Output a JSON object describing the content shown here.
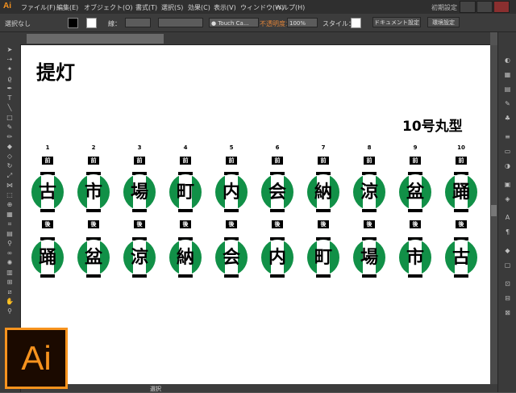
{
  "app": {
    "logo": "Ai",
    "menus": [
      "ファイル(F)",
      "編集(E)",
      "オブジェクト(O)",
      "書式(T)",
      "選択(S)",
      "効果(C)",
      "表示(V)",
      "ウィンドウ(W)",
      "ヘルプ(H)"
    ],
    "workspace": "初期設定",
    "brand_color": "#f7931e"
  },
  "control_bar": {
    "selection_label": "選択なし",
    "stroke_label": "線：",
    "brush_value": "Touch Ca...",
    "opacity_label": "不透明度：",
    "opacity_value": "100%",
    "style_label": "スタイル：",
    "document_settings_button": "ドキュメント設定",
    "preferences_button": "環境設定"
  },
  "status_bar": {
    "tool_label": "選択"
  },
  "artboard": {
    "title": "提灯",
    "subtitle": "10号丸型",
    "front_label": "前",
    "back_label": "後",
    "numbers": [
      "1",
      "2",
      "3",
      "4",
      "5",
      "6",
      "7",
      "8",
      "9",
      "10"
    ],
    "front_chars": [
      "古",
      "市",
      "場",
      "町",
      "内",
      "会",
      "納",
      "涼",
      "盆",
      "踊"
    ],
    "back_chars": [
      "踊",
      "盆",
      "涼",
      "納",
      "会",
      "内",
      "町",
      "場",
      "市",
      "古"
    ],
    "lantern_color": "#119047"
  },
  "badge": {
    "text": "Ai"
  }
}
